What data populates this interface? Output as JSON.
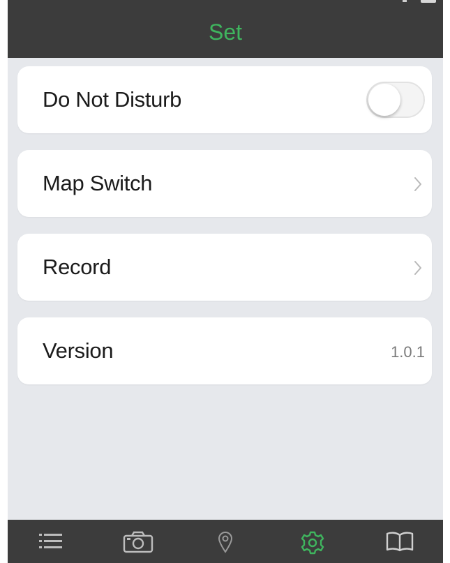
{
  "header": {
    "title": "Set"
  },
  "settings": {
    "items": [
      {
        "label": "Do Not Disturb",
        "type": "toggle",
        "toggle_on": false
      },
      {
        "label": "Map Switch",
        "type": "link"
      },
      {
        "label": "Record",
        "type": "link"
      },
      {
        "label": "Version",
        "type": "value",
        "value": "1.0.1"
      }
    ]
  },
  "tabbar": {
    "active_color": "#3fb55e",
    "inactive_color": "#bdbdbd",
    "tabs": [
      {
        "icon": "list-icon",
        "active": false
      },
      {
        "icon": "camera-icon",
        "active": false
      },
      {
        "icon": "location-pin-icon",
        "active": false
      },
      {
        "icon": "gear-icon",
        "active": true
      },
      {
        "icon": "book-icon",
        "active": false
      }
    ]
  }
}
